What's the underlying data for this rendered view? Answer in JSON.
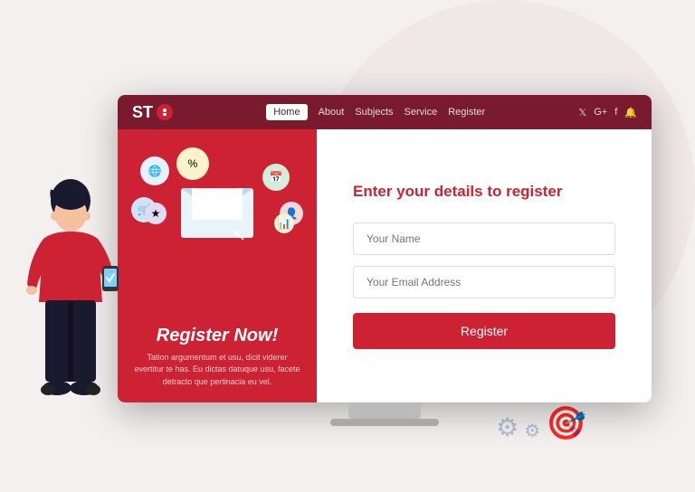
{
  "navbar": {
    "logo": "ST",
    "links": [
      {
        "label": "Home",
        "active": true
      },
      {
        "label": "About",
        "active": false
      },
      {
        "label": "Subjects",
        "active": false
      },
      {
        "label": "Service",
        "active": false
      },
      {
        "label": "Register",
        "active": false
      }
    ],
    "social": [
      "𝕏",
      "G+",
      "f",
      "🔔"
    ]
  },
  "left_panel": {
    "register_now": "Register Now!",
    "description": "Tation argumentum et usu, dicit viderer evertitur te has. Eu dictas datuque usu, facete detracto que pertinacia eu vel."
  },
  "right_panel": {
    "title": "Enter your details to register",
    "name_placeholder": "Your Name",
    "email_placeholder": "Your Email Address",
    "button_label": "Register"
  }
}
